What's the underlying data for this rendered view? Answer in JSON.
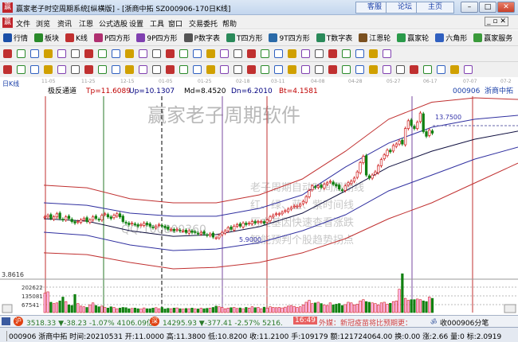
{
  "window": {
    "title": "赢家老子时空周期系统[纵横版] - [浙商中拓  SZ000906-170日K线]",
    "logo": "赢",
    "buttons": [
      "客服",
      "论坛",
      "主页"
    ]
  },
  "menu": [
    "文件",
    "浏览",
    "资讯",
    "江恩",
    "公式选股",
    "设置",
    "工具",
    "窗口",
    "交易委托",
    "帮助"
  ],
  "toolbar1": [
    {
      "icon": "quote-icon",
      "label": "行情",
      "color": "#1b4fa8"
    },
    {
      "icon": "sector-icon",
      "label": "板块",
      "color": "#2a8a2a"
    },
    {
      "icon": "kline-icon",
      "label": "K线",
      "color": "#c03030"
    },
    {
      "icon": "p-square-icon",
      "label": "P四方形",
      "color": "#b03070"
    },
    {
      "icon": "9p-square-icon",
      "label": "9P四方形",
      "color": "#8040b0"
    },
    {
      "icon": "p-number-table-icon",
      "label": "P数字表",
      "color": "#555"
    },
    {
      "icon": "t-square-icon",
      "label": "T四方形",
      "color": "#2a8a5a"
    },
    {
      "icon": "9t-square-icon",
      "label": "9T四方形",
      "color": "#2a6aa8"
    },
    {
      "icon": "t-number-table-icon",
      "label": "T数字表",
      "color": "#2a8a5a"
    },
    {
      "icon": "gann-wheel-icon",
      "label": "江恩轮",
      "color": "#7a5020"
    },
    {
      "icon": "winner-wheel-icon",
      "label": "赢家轮",
      "color": "#2a9a4a"
    },
    {
      "icon": "hexagon-icon",
      "label": "六角形",
      "color": "#3060c0"
    },
    {
      "icon": "service-icon",
      "label": "赢家服务",
      "color": "#3a9a3a"
    }
  ],
  "toolbar2_icons": [
    "period-icon",
    "chart-icon",
    "info-icon",
    "draw-icon",
    "draw2-icon",
    "bar-icon",
    "color-icon",
    "flag-icon",
    "first-icon",
    "last-icon",
    "prev-icon",
    "next-icon",
    "diamond1-icon",
    "diamond2-icon",
    "diamond3-icon",
    "diamond4-icon",
    "diamond5-icon",
    "diamond6-icon",
    "hand-icon",
    "crosshair-icon",
    "line-icon",
    "tool-icon",
    "calc-icon",
    "calendar-icon",
    "calculator-icon",
    "notes-icon",
    "save-icon",
    "print-icon",
    "export-icon"
  ],
  "toolbar3_icons": [
    "pen-icon",
    "lines-icon",
    "fan-icon",
    "fan2-icon",
    "fan3-icon",
    "arc-icon",
    "brush-icon",
    "circle-icon",
    "parallel-icon",
    "n2-icon",
    "more-icon",
    "box-icon",
    "gann-fan-icon",
    "grid-icon",
    "grid2-icon",
    "angle-icon",
    "wave-icon",
    "pattern-icon",
    "pattern2-icon",
    "ratio-icon",
    "ratio2-icon",
    "percent-icon",
    "fib-icon",
    "circle2-icon",
    "fib2-icon",
    "speed-icon",
    "tri-icon",
    "tri2-icon",
    "angle2-icon",
    "angle3-icon",
    "angle4-icon",
    "cycle-icon",
    "cycle2-icon",
    "layout1-icon",
    "layout2-icon"
  ],
  "chart": {
    "period_label": "日K线",
    "dates": [
      "11-05",
      "11-25",
      "12-15",
      "01-05",
      "01-25",
      "02-18",
      "03-11",
      "04-08",
      "04-28",
      "05-27",
      "06-17",
      "07-07",
      "07-2"
    ],
    "indicator_name": "极反通道",
    "indicators": [
      {
        "label": "Tp=11.6089",
        "color": "#c00000"
      },
      {
        "label": "Up=10.1307",
        "color": "#000080"
      },
      {
        "label": "Md=8.4520",
        "color": "#000000"
      },
      {
        "label": "Dn=6.2010",
        "color": "#000080"
      },
      {
        "label": "Bt=4.1581",
        "color": "#c00000"
      }
    ],
    "stock_code": "000906",
    "stock_name": "浙商中拓",
    "high_label": "13.7500",
    "low_label": "5.9000",
    "axis_min_label": "3.8616",
    "watermark_title": "赢家老子周期软件",
    "watermark_qq": "QQ:100800360",
    "watermark_lines": [
      "老子周期自动时间周期线",
      "红、绿、蓝、紫时间线",
      "历史基因快速查看涨跌",
      "智能预判个股趋势拐点"
    ],
    "closes": [
      7.3,
      7.4,
      7.2,
      7.3,
      7.5,
      7.2,
      7.1,
      7.3,
      7.2,
      7.0,
      6.9,
      7.0,
      7.1,
      7.2,
      7.0,
      7.1,
      7.3,
      7.2,
      7.1,
      7.4,
      7.5,
      7.3,
      7.2,
      7.4,
      7.5,
      7.3,
      7.0,
      6.9,
      6.8,
      6.9,
      6.8,
      6.7,
      6.8,
      6.9,
      6.8,
      6.7,
      6.6,
      6.7,
      6.8,
      6.7,
      6.6,
      6.5,
      6.5,
      6.4,
      6.5,
      6.4,
      6.4,
      6.3,
      6.4,
      6.3,
      6.3,
      6.2,
      6.3,
      6.2,
      6.1,
      6.2,
      6.0,
      5.95,
      6.1,
      6.3,
      6.4,
      6.6,
      6.5,
      6.7,
      6.8,
      6.7,
      6.9,
      6.8,
      6.9,
      7.0,
      6.9,
      7.0,
      7.0,
      6.9,
      7.1,
      7.3,
      7.4,
      7.5,
      7.5,
      7.6,
      7.7,
      7.8,
      7.9,
      8.0,
      8.0,
      8.1,
      8.3,
      8.6,
      9.0,
      9.3,
      9.2,
      9.3,
      9.2,
      9.4,
      9.5,
      9.6,
      9.4,
      9.3,
      9.1,
      9.0,
      9.3,
      9.5,
      9.6,
      9.8,
      10.2,
      10.8,
      11.2,
      10.0,
      9.8,
      10.0,
      10.2,
      10.6,
      11.0,
      11.3,
      11.6,
      11.5,
      11.9,
      12.0,
      12.2,
      12.0,
      13.0,
      13.5,
      13.2,
      13.0,
      13.4,
      14.0,
      12.8,
      12.5,
      12.9,
      12.7
    ],
    "bands": {
      "tp": [
        9.34,
        9.18,
        8.47,
        8.21,
        8.21,
        8.72,
        9.75,
        11.54,
        13.6,
        14.7,
        14.98,
        14.88
      ],
      "up": [
        8.21,
        8.05,
        7.54,
        7.34,
        7.34,
        7.85,
        8.72,
        10.52,
        12.06,
        13.08,
        13.6,
        13.85
      ],
      "md": [
        7.18,
        7.03,
        6.41,
        6.05,
        6.16,
        6.67,
        7.54,
        8.98,
        10.52,
        11.54,
        12.31,
        12.83
      ],
      "dn": [
        6.31,
        6.11,
        5.49,
        5.13,
        5.23,
        5.64,
        6.41,
        7.44,
        8.98,
        10.0,
        11.03,
        11.8
      ],
      "bt": [
        4.98,
        4.87,
        4.36,
        3.95,
        4.05,
        4.36,
        4.98,
        5.9,
        7.18,
        8.21,
        9.49,
        10.77
      ]
    },
    "volume_labels": [
      "202622",
      "135081",
      "67541"
    ],
    "volume_k": [
      150,
      160,
      80,
      70,
      75,
      90,
      120,
      85,
      60,
      55,
      140,
      70,
      50,
      45,
      40,
      60,
      75,
      55,
      45,
      50,
      40,
      35,
      45,
      40,
      30,
      35,
      40,
      38,
      30,
      32,
      35,
      30,
      28,
      36,
      30,
      30,
      35,
      38,
      30,
      40,
      28,
      33,
      30,
      35,
      36,
      30,
      28,
      32,
      30,
      35,
      30,
      28,
      34,
      30,
      33,
      35,
      40,
      50,
      45,
      40,
      30,
      35,
      38,
      40,
      32,
      36,
      30,
      40,
      35,
      45,
      38,
      40,
      30,
      42,
      35,
      45,
      40,
      38,
      40,
      36,
      42,
      50,
      55,
      48,
      40,
      45,
      60,
      80,
      95,
      70,
      75,
      80,
      70,
      60,
      55,
      75,
      60,
      65,
      70,
      55,
      62,
      80,
      75,
      60,
      65,
      90,
      100,
      85,
      80,
      75,
      70,
      60,
      75,
      80,
      65,
      72,
      85,
      90,
      180,
      300,
      110,
      95,
      100,
      100,
      105,
      100,
      90,
      85,
      120,
      110
    ]
  },
  "status": {
    "sh_index": "3518.33 ▼-38.23 -1.07% 4106.09亿",
    "sh_badge": "沪",
    "sz_index": "14295.93 ▼-377.41 -2.57% 5216.0亿",
    "sz_badge": "深",
    "time": "16:49",
    "news": "外媒：新冠疫苗将比预期更：",
    "tick_label": "收000906分笔"
  },
  "bottom": {
    "info": "000906 浙商中拓 时间:20210531 开:11.0000 高:11.3800 低:10.8200 收:11.2100 手:109179 额:121724064.00 换:0.00 涨:2.66 量:0 标:2.0919"
  }
}
